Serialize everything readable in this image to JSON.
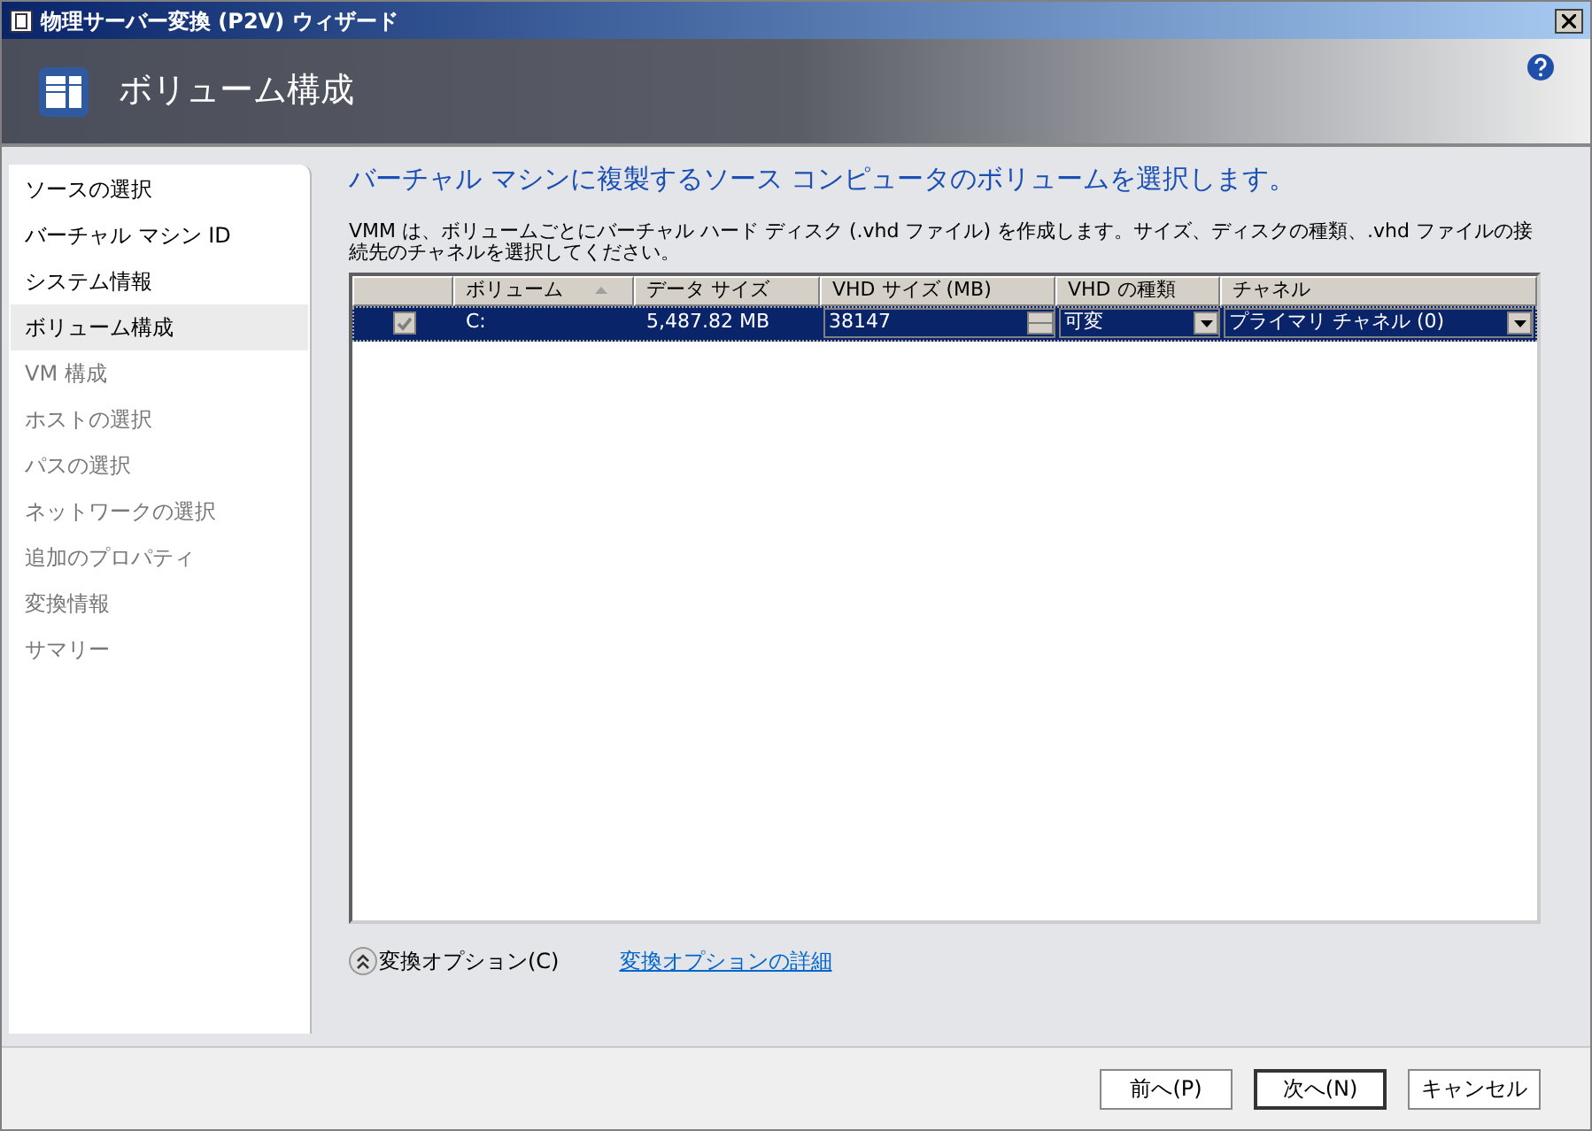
{
  "window": {
    "title": "物理サーバー変換 (P2V) ウィザード"
  },
  "header": {
    "title": "ボリューム構成"
  },
  "sidebar": {
    "items": [
      {
        "label": "ソースの選択",
        "selected": false,
        "disabled": false
      },
      {
        "label": "バーチャル マシン ID",
        "selected": false,
        "disabled": false
      },
      {
        "label": "システム情報",
        "selected": false,
        "disabled": false
      },
      {
        "label": "ボリューム構成",
        "selected": true,
        "disabled": false
      },
      {
        "label": "VM 構成",
        "selected": false,
        "disabled": true
      },
      {
        "label": "ホストの選択",
        "selected": false,
        "disabled": true
      },
      {
        "label": "パスの選択",
        "selected": false,
        "disabled": true
      },
      {
        "label": "ネットワークの選択",
        "selected": false,
        "disabled": true
      },
      {
        "label": "追加のプロパティ",
        "selected": false,
        "disabled": true
      },
      {
        "label": "変換情報",
        "selected": false,
        "disabled": true
      },
      {
        "label": "サマリー",
        "selected": false,
        "disabled": true
      }
    ]
  },
  "content": {
    "heading": "バーチャル マシンに複製するソース コンピュータのボリュームを選択します。",
    "description": " VMM は、ボリュームごとにバーチャル ハード ディスク (.vhd ファイル) を作成します。サイズ、ディスクの種類、.vhd ファイルの接続先のチャネルを選択してください。"
  },
  "table": {
    "columns": [
      {
        "sorted": false
      },
      {
        "label": "ボリューム",
        "sorted": true
      },
      {
        "label": "データ サイズ",
        "sorted": false
      },
      {
        "label": "VHD サイズ (MB)",
        "sorted": false
      },
      {
        "label": "VHD の種類",
        "sorted": false
      },
      {
        "label": "チャネル",
        "sorted": false
      }
    ],
    "rows": [
      {
        "selected": true,
        "checked": true,
        "volume": "C:",
        "data_size": "5,487.82 MB",
        "vhd_size": "38147",
        "vhd_type": "可変",
        "channel": "プライマリ チャネル (0)"
      }
    ]
  },
  "options": {
    "toggle_label": "変換オプション(C)",
    "expanded": false,
    "link": "変換オプションの詳細"
  },
  "buttons": [
    {
      "label": "前へ(P)",
      "default": false
    },
    {
      "label": "次へ(N)",
      "default": true
    },
    {
      "label": "キャンセル",
      "default": false
    }
  ]
}
